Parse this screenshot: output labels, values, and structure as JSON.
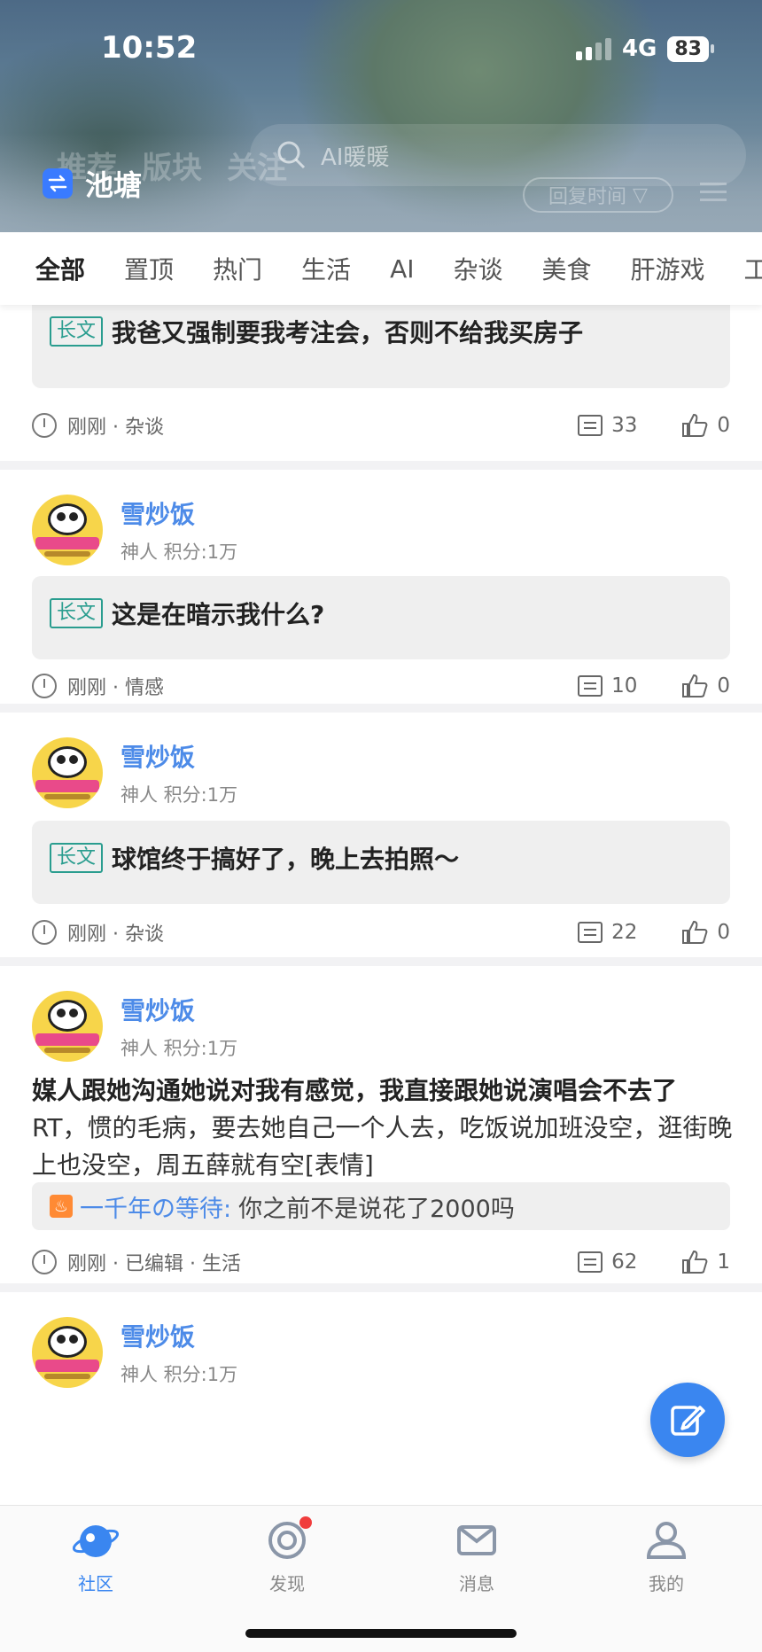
{
  "status_bar": {
    "time": "10:52",
    "network": "4G",
    "battery": "83"
  },
  "header": {
    "faint_tabs": [
      "推荐",
      "版块",
      "关注"
    ],
    "search_placeholder": "AI暖暖",
    "sort_label": "回复时间",
    "board_name": "池塘"
  },
  "category_tabs": [
    "全部",
    "置顶",
    "热门",
    "生活",
    "AI",
    "杂谈",
    "美食",
    "肝游戏",
    "工"
  ],
  "posts": [
    {
      "title": "我爸又强制要我考注会，否则不给我买房子",
      "tag": "长文",
      "footer_meta": "刚刚 · 杂谈",
      "comments": "33",
      "likes": "0"
    },
    {
      "user": "雪炒饭",
      "user_meta": "神人   积分:1万",
      "tag": "长文",
      "title": "这是在暗示我什么?",
      "footer_meta": "刚刚 · 情感",
      "comments": "10",
      "likes": "0"
    },
    {
      "user": "雪炒饭",
      "user_meta": "神人   积分:1万",
      "tag": "长文",
      "title": "球馆终于搞好了，晚上去拍照～",
      "footer_meta": "刚刚 · 杂谈",
      "comments": "22",
      "likes": "0"
    },
    {
      "user": "雪炒饭",
      "user_meta": "神人   积分:1万",
      "title_bold": "媒人跟她沟通她说对我有感觉，我直接跟她说演唱会不去了",
      "body": "RT，惯的毛病，要去她自己一个人去，吃饭说加班没空，逛街晚上也没空，周五薛就有空[表情]",
      "reply_user": "一千年の等待:",
      "reply_text": "你之前不是说花了2000吗",
      "footer_meta": "刚刚 · 已编辑 · 生活",
      "comments": "62",
      "likes": "1"
    },
    {
      "user": "雪炒饭",
      "user_meta": "神人   积分:1万"
    }
  ],
  "bottom_nav": [
    {
      "label": "社区",
      "active": true
    },
    {
      "label": "发现",
      "active": false
    },
    {
      "label": "消息",
      "active": false
    },
    {
      "label": "我的",
      "active": false
    }
  ],
  "colors": {
    "accent": "#3a86f0",
    "user_blue": "#4d8be8",
    "tag_green": "#2a9d8f"
  },
  "icons": [
    "switch-board-icon",
    "search-icon",
    "clock-icon",
    "comment-icon",
    "like-icon",
    "fire-icon",
    "edit-icon",
    "community-icon",
    "discover-icon",
    "message-icon",
    "profile-icon"
  ]
}
